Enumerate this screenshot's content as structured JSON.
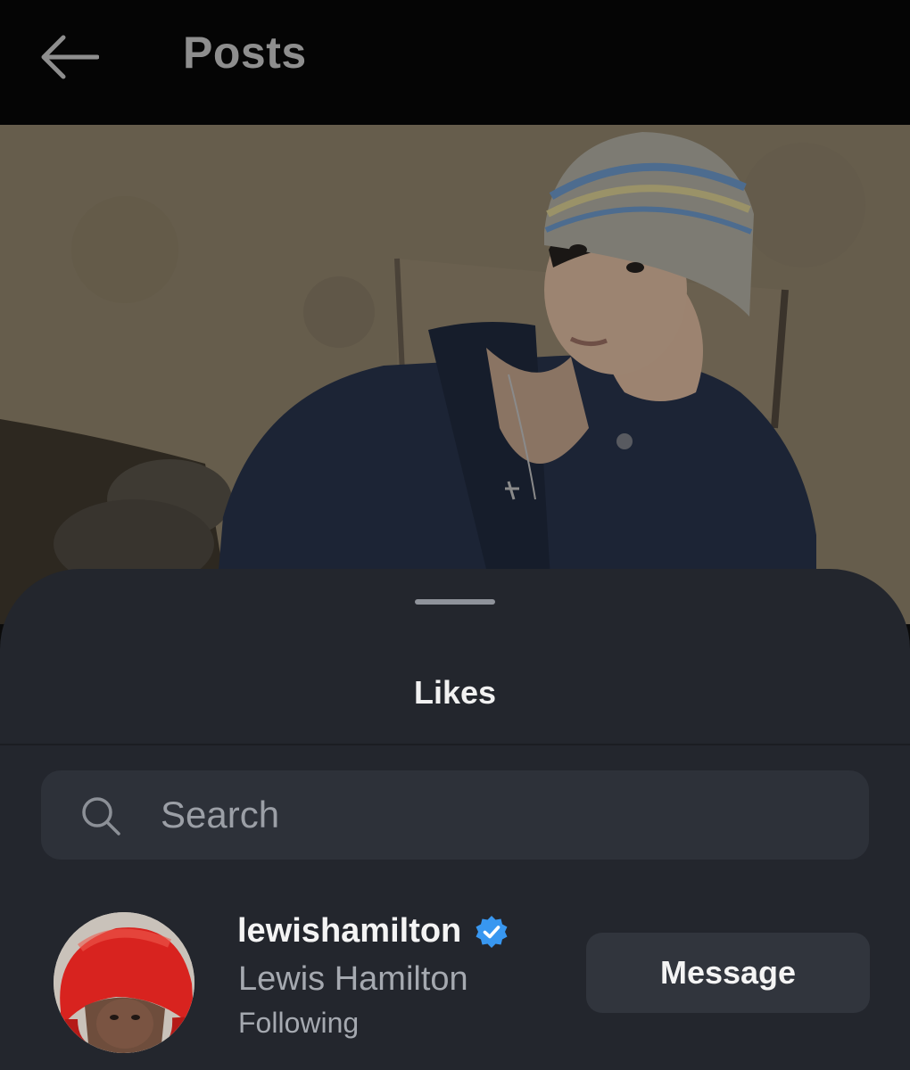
{
  "header": {
    "back_icon": "arrow-left-icon",
    "title": "Posts"
  },
  "post": {
    "image_alt": "Post photo"
  },
  "likes_sheet": {
    "title": "Likes",
    "search": {
      "icon": "search-icon",
      "placeholder": "Search",
      "value": ""
    },
    "users": [
      {
        "username": "lewishamilton",
        "verified": true,
        "full_name": "Lewis Hamilton",
        "status": "Following",
        "action_label": "Message"
      }
    ]
  },
  "colors": {
    "header_bg": "#050505",
    "sheet_bg": "#23262d",
    "search_bg": "#2d3139",
    "button_bg": "#31353d",
    "verified_blue": "#3897f0",
    "muted_text": "#a5a9b0",
    "title_muted": "#8e8e8e"
  }
}
